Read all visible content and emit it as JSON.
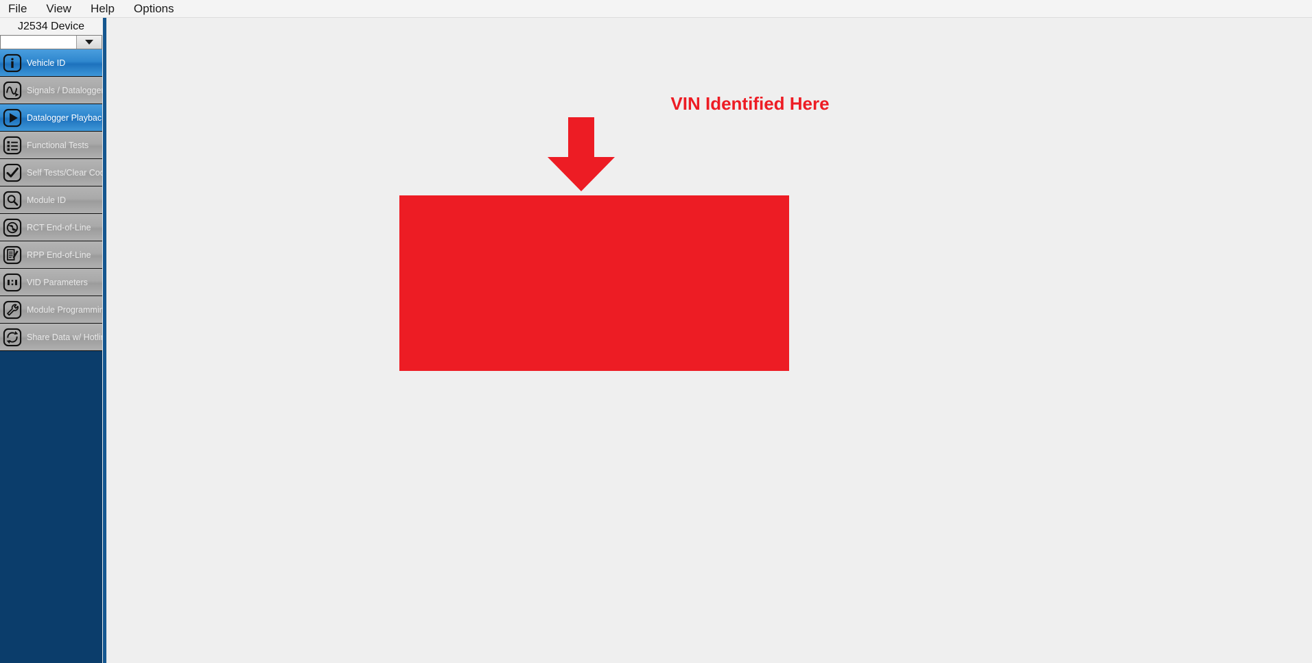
{
  "menubar": {
    "items": [
      {
        "label": "File",
        "name": "menu-file"
      },
      {
        "label": "View",
        "name": "menu-view"
      },
      {
        "label": "Help",
        "name": "menu-help"
      },
      {
        "label": "Options",
        "name": "menu-options"
      }
    ]
  },
  "sidebar": {
    "device_header": "J2534 Device",
    "device_combo_value": "",
    "items": [
      {
        "label": "Vehicle ID",
        "icon": "info-icon",
        "active": true
      },
      {
        "label": "Signals / Datalogger",
        "icon": "waveform-icon",
        "active": false
      },
      {
        "label": "Datalogger Playback",
        "icon": "play-icon",
        "active": true
      },
      {
        "label": "Functional Tests",
        "icon": "list-icon",
        "active": false
      },
      {
        "label": "Self Tests/Clear Codes",
        "icon": "checkmark-icon",
        "active": false
      },
      {
        "label": "Module ID",
        "icon": "magnifier-icon",
        "active": false
      },
      {
        "label": "RCT End-of-Line",
        "icon": "globe-icon",
        "active": false
      },
      {
        "label": "RPP End-of-Line",
        "icon": "document-edit-icon",
        "active": false
      },
      {
        "label": "VID Parameters",
        "icon": "ratio-icon",
        "active": false
      },
      {
        "label": "Module Programming",
        "icon": "wrench-icon",
        "active": false
      },
      {
        "label": "Share Data w/ Hotline",
        "icon": "sync-icon",
        "active": false
      }
    ]
  },
  "main": {
    "annotation_title": "VIN Identified Here"
  },
  "colors": {
    "accent_red": "#ed1c24",
    "sidebar_navy": "#0b3d6b",
    "active_blue": "#2f87ce",
    "nav_gray": "#a9a9a9"
  }
}
